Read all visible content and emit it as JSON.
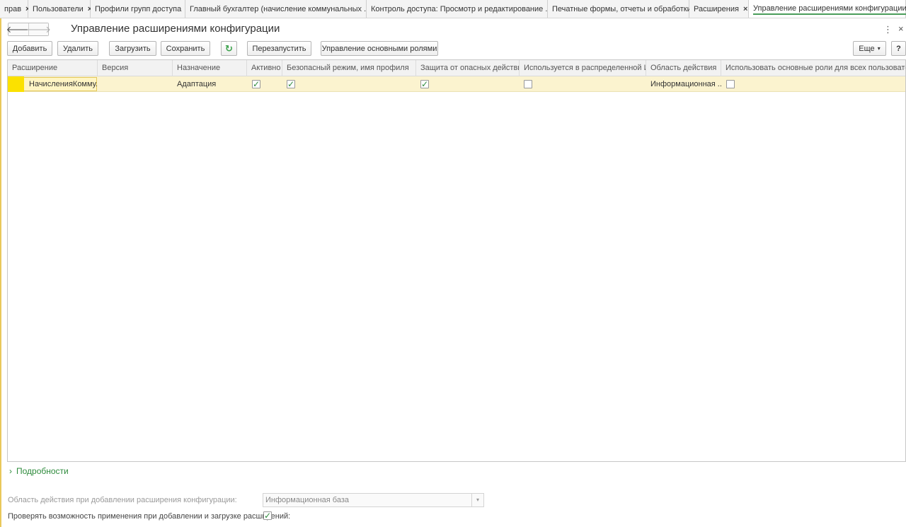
{
  "tabs": [
    {
      "label": "прав",
      "active": false
    },
    {
      "label": "Пользователи",
      "active": false
    },
    {
      "label": "Профили групп доступа",
      "active": false
    },
    {
      "label": "Главный бухгалтер (начисление коммунальных ...",
      "active": false
    },
    {
      "label": "Контроль доступа: Просмотр и редактирование ...",
      "active": false
    },
    {
      "label": "Печатные формы, отчеты и обработки",
      "active": false
    },
    {
      "label": "Расширения",
      "active": false
    },
    {
      "label": "Управление расширениями конфигурации",
      "active": true
    }
  ],
  "tab_close_glyph": "×",
  "header": {
    "back_glyph": "🡐",
    "forward_glyph": "🡒",
    "title": "Управление расширениями конфигурации",
    "menu_glyph": "⋮",
    "close_glyph": "×"
  },
  "toolbar": {
    "add": "Добавить",
    "delete": "Удалить",
    "load": "Загрузить",
    "save": "Сохранить",
    "refresh_glyph": "↻",
    "restart": "Перезапустить",
    "manage_roles": "Управление основными ролями",
    "more": "Еще",
    "more_arrow": "▾",
    "help": "?"
  },
  "table": {
    "columns": [
      "Расширение",
      "Версия",
      "Назначение",
      "Активно",
      "Безопасный режим, имя профиля",
      "Защита от опасных действий",
      "Используется в распределенной ИБ",
      "Область действия",
      "Использовать основные роли для всех пользователей"
    ],
    "rows": [
      {
        "name": "НачисленияКомму...",
        "version": "",
        "purpose": "Адаптация",
        "active": true,
        "safe_mode": true,
        "protection": true,
        "distributed": false,
        "scope": "Информационная ...",
        "use_roles": false
      }
    ]
  },
  "details": {
    "chevron_glyph": "›",
    "label": "Подробности"
  },
  "settings": {
    "scope_label": "Область действия при добавлении расширения конфигурации:",
    "scope_value": "Информационная база",
    "scope_arrow": "▾",
    "check_label": "Проверять возможность применения при добавлении и загрузке расширений:",
    "check_value": true
  },
  "colors": {
    "accent_green": "#2e8b3c",
    "row_highlight": "#fbf3cf",
    "row_marker": "#fbe100"
  }
}
